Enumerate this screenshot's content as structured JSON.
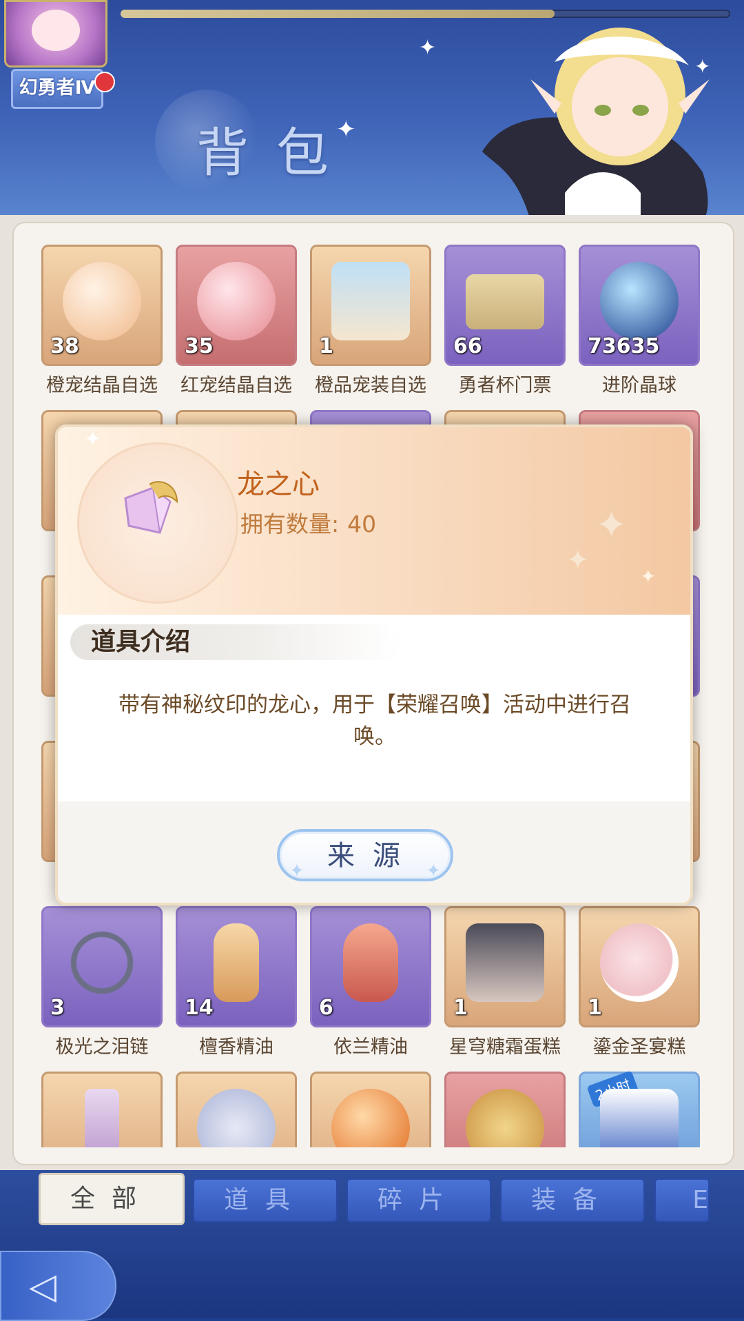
{
  "header": {
    "player_badge": "幻勇者Ⅳ",
    "page_title": "背包"
  },
  "items_row1": [
    {
      "name": "橙宠结晶自选",
      "count": "38",
      "rarity": "orange"
    },
    {
      "name": "红宠结晶自选",
      "count": "35",
      "rarity": "red"
    },
    {
      "name": "橙品宠装自选",
      "count": "1",
      "rarity": "orange"
    },
    {
      "name": "勇者杯门票",
      "count": "66",
      "rarity": "purple"
    },
    {
      "name": "进阶晶球",
      "count": "73635",
      "rarity": "purple"
    }
  ],
  "items_row6": [
    {
      "name": "极光之泪链",
      "count": "3",
      "rarity": "purple"
    },
    {
      "name": "檀香精油",
      "count": "14",
      "rarity": "purple"
    },
    {
      "name": "依兰精油",
      "count": "6",
      "rarity": "purple"
    },
    {
      "name": "星穹糖霜蛋糕",
      "count": "1",
      "rarity": "orange"
    },
    {
      "name": "鎏金圣宴糕",
      "count": "1",
      "rarity": "orange"
    }
  ],
  "items_row7_badge": "2小时",
  "tabs": [
    "全部",
    "道具",
    "碎片",
    "装备",
    "E"
  ],
  "modal": {
    "item_name": "龙之心",
    "owned_label": "拥有数量:",
    "owned_value": "40",
    "section_title": "道具介绍",
    "description": "带有神秘纹印的龙心，用于【荣耀召唤】活动中进行召唤。",
    "source_button": "来源"
  },
  "colors": {
    "title_orange": "#c2611c",
    "desc_brown": "#6b4a27",
    "button_border": "#9cc4ef"
  }
}
